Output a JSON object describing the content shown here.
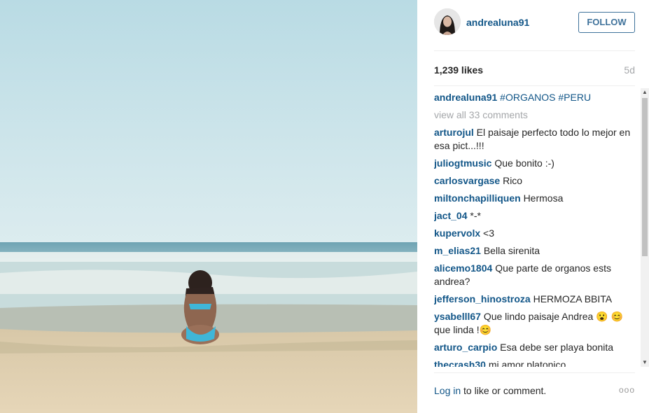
{
  "post": {
    "username": "andrealuna91",
    "follow_label": "FOLLOW",
    "likes": "1,239 likes",
    "age": "5d",
    "caption": {
      "author": "andrealuna91",
      "hashtags": "#ORGANOS #PERU"
    },
    "view_all": "view all 33 comments",
    "comments": [
      {
        "author": "arturojul",
        "text": "El paisaje perfecto todo lo mejor en esa pict...!!!"
      },
      {
        "author": "juliogtmusic",
        "text": "Que bonito :-)"
      },
      {
        "author": "carlosvargase",
        "text": "Rico"
      },
      {
        "author": "miltonchapilliquen",
        "text": "Hermosa"
      },
      {
        "author": "jact_04",
        "text": "*-*"
      },
      {
        "author": "kupervolx",
        "text": "<3"
      },
      {
        "author": "m_elias21",
        "text": "Bella sirenita"
      },
      {
        "author": "alicemo1804",
        "text": "Que parte de organos ests andrea?"
      },
      {
        "author": "jefferson_hinostroza",
        "text": "HERMOZA BBITA"
      },
      {
        "author": "ysabelll67",
        "text": "Que lindo paisaje Andrea 😮 😊 que linda !😊"
      },
      {
        "author": "arturo_carpio",
        "text": "Esa debe ser playa bonita"
      },
      {
        "author": "thecrash30",
        "text": "mi amor platonico"
      }
    ],
    "footer": {
      "login": "Log in",
      "text": "to like or comment.",
      "more": "ooo"
    }
  },
  "icons": {
    "scroll_up": "scroll-up-arrow",
    "scroll_down": "scroll-down-arrow",
    "more": "more-options-icon"
  },
  "colors": {
    "link": "#125688",
    "follow": "#3f729b",
    "muted": "#a5a7aa"
  }
}
